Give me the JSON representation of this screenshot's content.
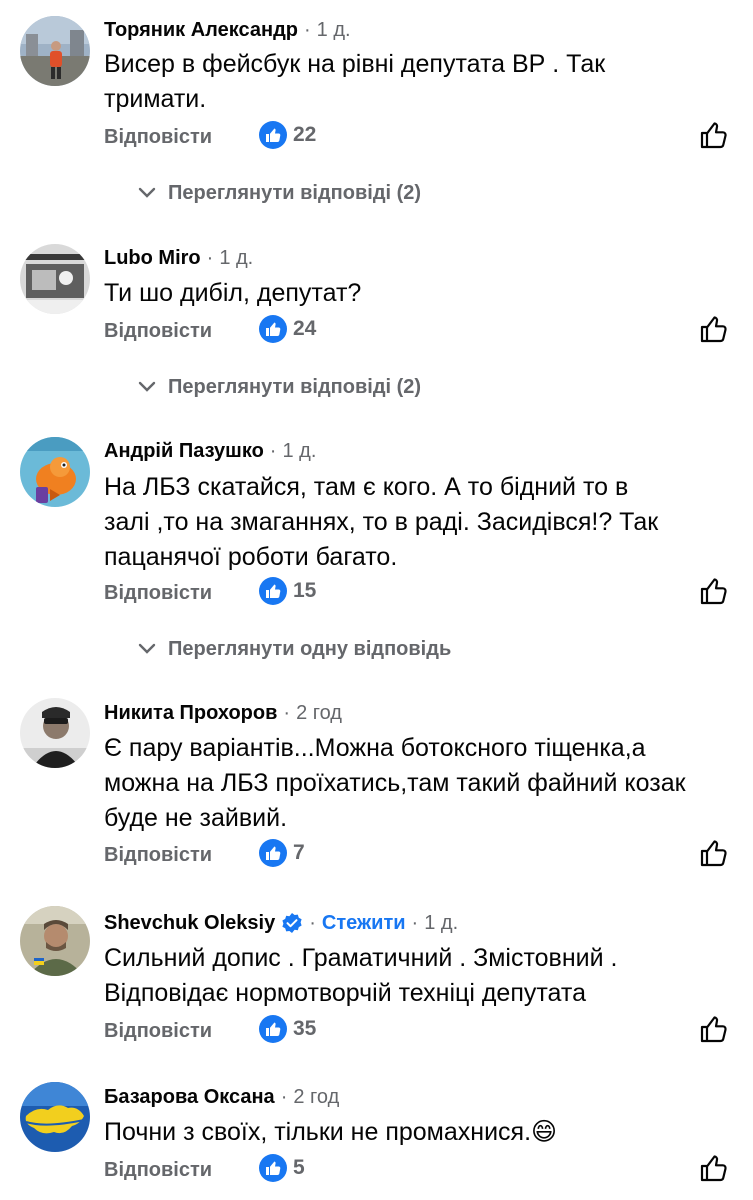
{
  "common": {
    "reply_label": "Відповісти"
  },
  "colors": {
    "like_blue": "#1877f2",
    "secondary_text": "#65676b",
    "primary_text": "#050505"
  },
  "comments": [
    {
      "author": "Торяник Александр",
      "time": "1 д.",
      "text_lines": [
        "Висер в фейсбук на рівні  депутата ВР . Так",
        "тримати."
      ],
      "likes": "22",
      "view_replies": "Переглянути відповіді (2)"
    },
    {
      "author": "Lubo Miro",
      "time": "1 д.",
      "text_lines": [
        "Ти шо дибіл, депутат?"
      ],
      "likes": "24",
      "view_replies": "Переглянути відповіді (2)"
    },
    {
      "author": "Андрій Пазушко",
      "time": "1 д.",
      "text_lines": [
        "На ЛБЗ скатайся, там є кого. А то бідний то в",
        "залі ,то на змаганнях, то в раді. Засидівся!?  Так",
        "пацанячої роботи багато."
      ],
      "likes": "15",
      "view_replies": "Переглянути одну відповідь"
    },
    {
      "author": "Никита Прохоров",
      "time": "2 год",
      "text_lines": [
        "Є пару варіантів...Можна ботоксного тіщенка,а",
        "можна на ЛБЗ проїхатись,там такий файний козак",
        "буде не зайвий."
      ],
      "likes": "7"
    },
    {
      "author": "Shevchuk Oleksiy",
      "follow": "Стежити",
      "time": "1 д.",
      "text_lines": [
        "Сильний допис  . Граматичний . Змістовний .",
        "Відповідає нормотворчій техніці депутата"
      ],
      "likes": "35"
    },
    {
      "author": "Базарова Оксана",
      "time": "2 год",
      "text_lines": [
        "Почни з своїх, тільки не промахнися.😄"
      ],
      "likes": "5"
    }
  ]
}
